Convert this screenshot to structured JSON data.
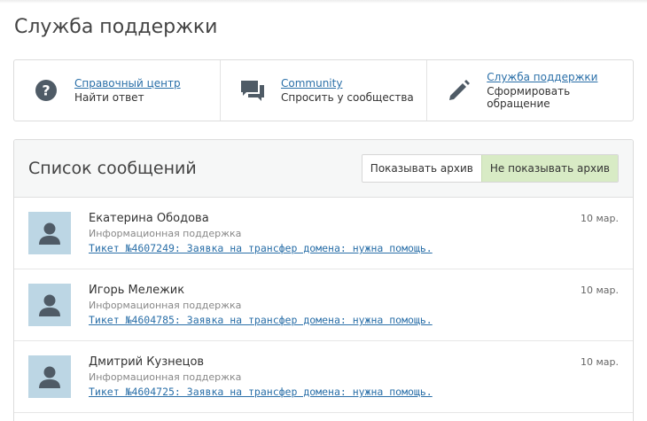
{
  "page": {
    "title": "Служба поддержки"
  },
  "cards": [
    {
      "title": "Справочный центр",
      "subtitle": "Найти ответ",
      "icon": "help-icon"
    },
    {
      "title": "Community",
      "subtitle": "Спросить у сообщества",
      "icon": "chat-icon"
    },
    {
      "title": "Служба поддержки",
      "subtitle": "Сформировать обращение",
      "icon": "pencil-icon"
    }
  ],
  "messages_panel": {
    "title": "Список сообщений",
    "show_archive": "Показывать архив",
    "hide_archive": "Не показывать архив",
    "active_filter": "hide_archive"
  },
  "messages": [
    {
      "name": "Екатерина Ободова",
      "department": "Информационная поддержка",
      "ticket": "Тикет №4607249: Заявка на трансфер домена: нужна помощь.",
      "date": "10 мар."
    },
    {
      "name": "Игорь Мележик",
      "department": "Информационная поддержка",
      "ticket": "Тикет №4604785: Заявка на трансфер домена: нужна помощь.",
      "date": "10 мар."
    },
    {
      "name": "Дмитрий Кузнецов",
      "department": "Информационная поддержка",
      "ticket": "Тикет №4604725: Заявка на трансфер домена: нужна помощь.",
      "date": "10 мар."
    }
  ],
  "colors": {
    "accent": "#2a6fa8",
    "active_toggle": "#d8ebc5",
    "avatar_bg": "#bcd6e4",
    "icon": "#4f5b66"
  }
}
